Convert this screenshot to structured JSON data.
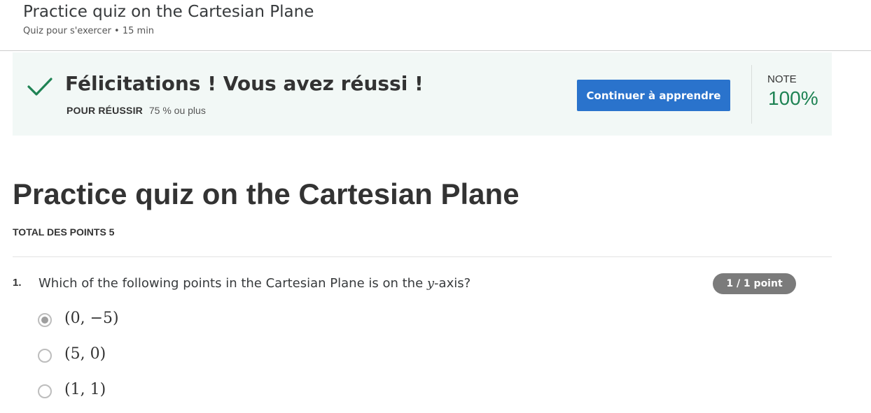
{
  "header": {
    "title": "Practice quiz on the Cartesian Plane",
    "subtitle": "Quiz pour s'exercer • 15  min"
  },
  "banner": {
    "message": "Félicitations ! Vous avez réussi !",
    "pass_label": "POUR RÉUSSIR",
    "pass_value": "75 % ou plus",
    "continue_button": "Continuer à apprendre",
    "grade_label": "NOTE",
    "grade_value": "100%",
    "accent_color": "#1f8354"
  },
  "quiz": {
    "title": "Practice quiz on the Cartesian Plane",
    "total_points": "TOTAL DES POINTS 5"
  },
  "question": {
    "number": "1.",
    "text_before": "Which of the following points in the Cartesian Plane is on the ",
    "variable": "y",
    "text_after": "-axis?",
    "points_badge": "1 / 1 point",
    "options": [
      {
        "label": "(0, −5)",
        "selected": true
      },
      {
        "label": "(5, 0)",
        "selected": false
      },
      {
        "label": "(1, 1)",
        "selected": false
      }
    ]
  }
}
